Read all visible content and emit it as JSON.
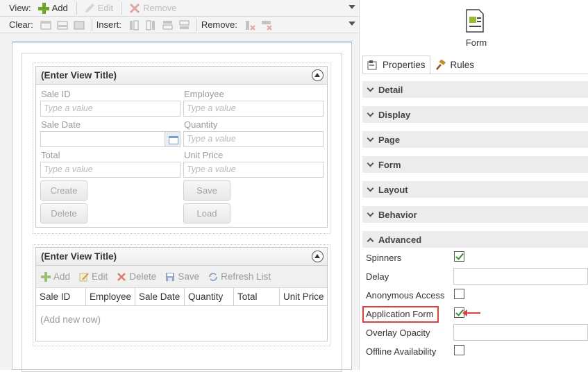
{
  "toolbar1": {
    "view_label": "View:",
    "add": "Add",
    "edit": "Edit",
    "remove": "Remove"
  },
  "toolbar2": {
    "clear_label": "Clear:",
    "insert_label": "Insert:",
    "remove_label": "Remove:"
  },
  "view1": {
    "title": "(Enter View Title)",
    "fields": {
      "sale_id": "Sale ID",
      "employee": "Employee",
      "sale_date": "Sale Date",
      "quantity": "Quantity",
      "total": "Total",
      "unit_price": "Unit Price"
    },
    "placeholder": "Type a value",
    "buttons": {
      "create": "Create",
      "save": "Save",
      "delete": "Delete",
      "load": "Load"
    }
  },
  "view2": {
    "title": "(Enter View Title)",
    "toolbar": {
      "add": "Add",
      "edit": "Edit",
      "delete": "Delete",
      "save": "Save",
      "refresh": "Refresh List"
    },
    "columns": [
      "Sale ID",
      "Employee",
      "Sale Date",
      "Quantity",
      "Total",
      "Unit Price"
    ],
    "empty_row": "(Add new row)"
  },
  "properties": {
    "object_caption": "Form",
    "tabs": [
      "Properties",
      "Rules"
    ],
    "sections": [
      "Detail",
      "Display",
      "Page",
      "Form",
      "Layout",
      "Behavior",
      "Advanced"
    ],
    "advanced": {
      "spinners": {
        "label": "Spinners",
        "checked": true
      },
      "delay": {
        "label": "Delay",
        "value": ""
      },
      "anonymous_access": {
        "label": "Anonymous Access",
        "checked": false
      },
      "application_form": {
        "label": "Application Form",
        "checked": true
      },
      "overlay_opacity": {
        "label": "Overlay Opacity",
        "value": ""
      },
      "offline_availability": {
        "label": "Offline Availability",
        "checked": false
      }
    }
  },
  "colors": {
    "accent_green": "#3a8a2a",
    "highlight_red": "#e0403a",
    "canvas_top_border": "#4a8dc7"
  }
}
